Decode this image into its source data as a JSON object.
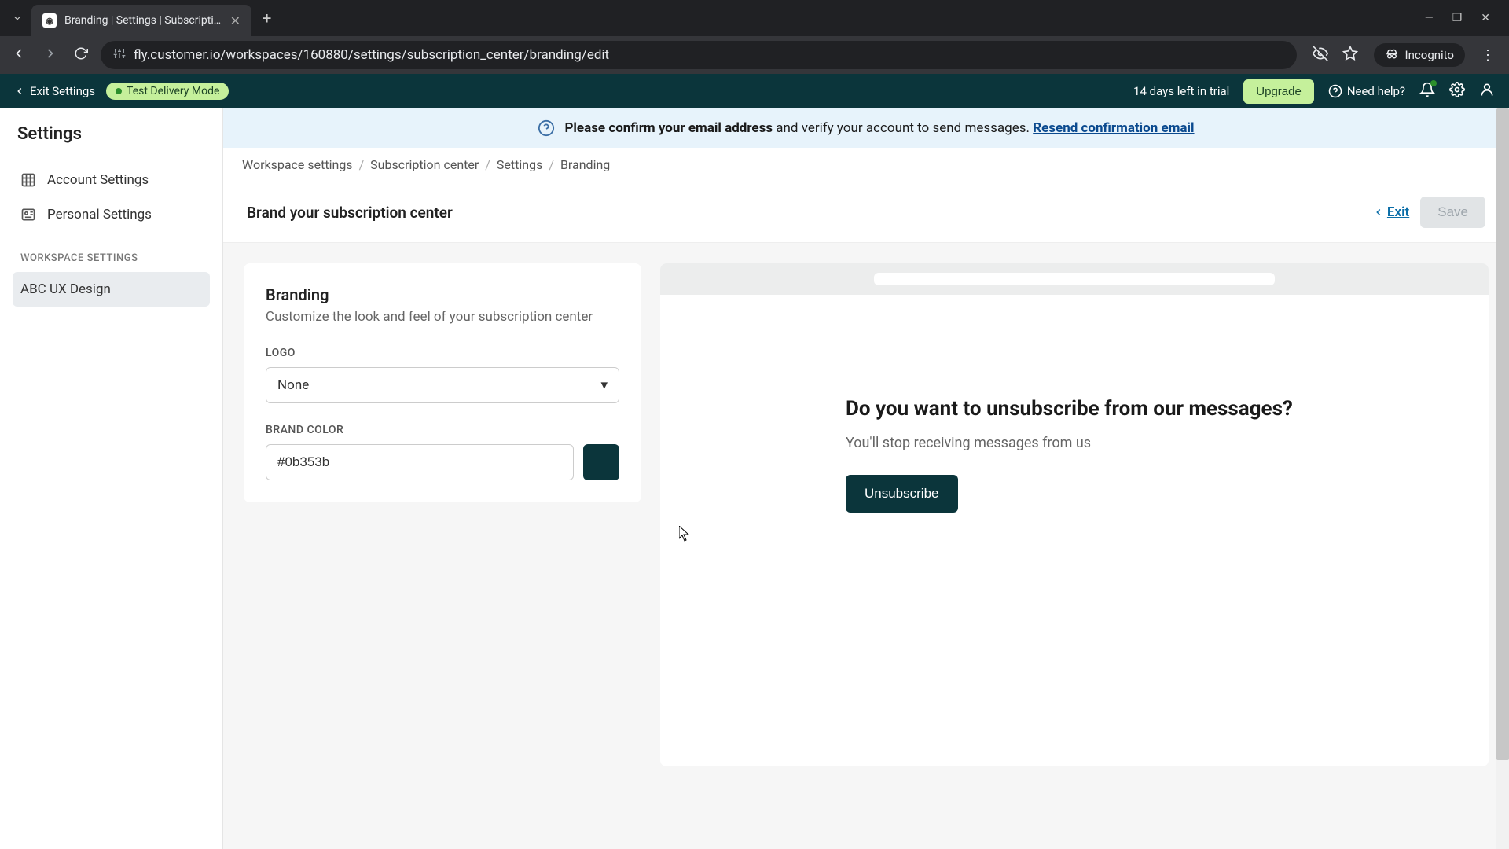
{
  "browser": {
    "tab_title": "Branding | Settings | Subscripti...",
    "url": "fly.customer.io/workspaces/160880/settings/subscription_center/branding/edit",
    "incognito_label": "Incognito"
  },
  "topbar": {
    "exit_settings": "Exit Settings",
    "test_mode": "Test Delivery Mode",
    "trial": "14 days left in trial",
    "upgrade": "Upgrade",
    "need_help": "Need help?"
  },
  "sidebar": {
    "title": "Settings",
    "account": "Account Settings",
    "personal": "Personal Settings",
    "ws_label": "WORKSPACE SETTINGS",
    "ws_name": "ABC UX Design"
  },
  "banner": {
    "bold": "Please confirm your email address",
    "rest": " and verify your account to send messages. ",
    "link": "Resend confirmation email"
  },
  "breadcrumb": {
    "a": "Workspace settings",
    "b": "Subscription center",
    "c": "Settings",
    "d": "Branding"
  },
  "page_header": {
    "title": "Brand your subscription center",
    "exit": "Exit",
    "save": "Save"
  },
  "branding_card": {
    "title": "Branding",
    "sub": "Customize the look and feel of your subscription center",
    "logo_label": "LOGO",
    "logo_value": "None",
    "color_label": "BRAND COLOR",
    "color_value": "#0b353b"
  },
  "preview": {
    "heading": "Do you want to unsubscribe from our messages?",
    "sub": "You'll stop receiving messages from us",
    "button": "Unsubscribe"
  },
  "colors": {
    "brand": "#0b353b",
    "accent_green": "#c5f09b"
  }
}
